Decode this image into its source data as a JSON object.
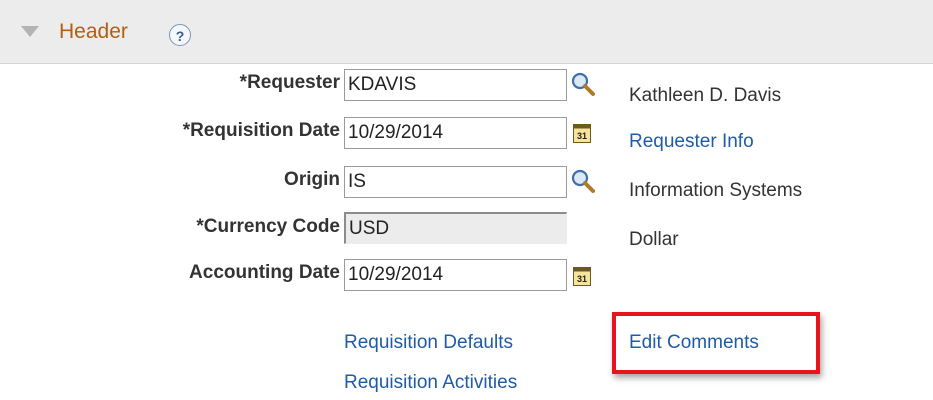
{
  "header": {
    "title": "Header",
    "help_label": "?",
    "collapse_icon": "triangle-down-icon"
  },
  "fields": {
    "requester": {
      "label": "*Requester",
      "value": "KDAVIS",
      "description": "Kathleen D. Davis"
    },
    "requisition_date": {
      "label": "*Requisition Date",
      "value": "10/29/2014"
    },
    "origin": {
      "label": "Origin",
      "value": "IS",
      "description": "Information Systems"
    },
    "currency_code": {
      "label": "*Currency Code",
      "value": "USD",
      "description": "Dollar"
    },
    "accounting_date": {
      "label": "Accounting Date",
      "value": "10/29/2014"
    }
  },
  "calendar_icon_text": "31",
  "links": {
    "requester_info": "Requester Info",
    "requisition_defaults": "Requisition Defaults",
    "edit_comments": "Edit Comments",
    "requisition_activities": "Requisition Activities"
  },
  "colors": {
    "header_title": "#b45f0f",
    "link": "#1e5ca8",
    "highlight": "#e8141b",
    "header_background": "#ececec"
  }
}
